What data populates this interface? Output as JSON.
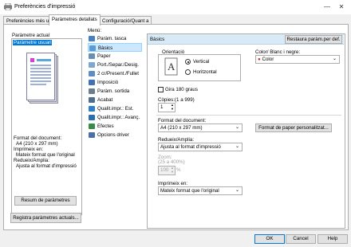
{
  "window": {
    "title": "Preferències d'impressió",
    "app_icon": "printer-icon"
  },
  "tabs": [
    {
      "label": "Preferències més usats",
      "active": false
    },
    {
      "label": "Paràmetres detallats",
      "active": true
    },
    {
      "label": "Configuració/Quant a",
      "active": false
    }
  ],
  "left": {
    "current_label": "Paràmetre actual",
    "current_value": "Paràmetre usuari",
    "summary": {
      "doc_format_label": "Format del document:",
      "doc_format_value": "A4 (210 x 297 mm)",
      "print_on_label": "Imprimeix en:",
      "print_on_value": "Mateix format que l'original",
      "reduce_label": "Redueix/Amplia:",
      "reduce_value": "Ajusta al format d'impressió"
    },
    "summary_button": "Resum de paràmetres",
    "register_button": "Registra paràmetres actuals..."
  },
  "menu": {
    "label": "Menú:",
    "items": [
      {
        "label": "Paràm. tasca",
        "icon": "job-settings-icon",
        "color": "#4a7fc1",
        "selected": false
      },
      {
        "label": "Bàsics",
        "icon": "basic-settings-icon",
        "color": "#5a9bd5",
        "selected": true
      },
      {
        "label": "Paper",
        "icon": "paper-icon",
        "color": "#6b8fb0",
        "selected": false
      },
      {
        "label": "Port./Separ./Desig.",
        "icon": "cover-icon",
        "color": "#7ea6cf",
        "selected": false
      },
      {
        "label": "2 cr/Present./Fullet",
        "icon": "duplex-icon",
        "color": "#5e8cc4",
        "selected": false
      },
      {
        "label": "Imposició",
        "icon": "imposition-icon",
        "color": "#3f72b5",
        "selected": false
      },
      {
        "label": "Paràm. sortida",
        "icon": "output-icon",
        "color": "#6c7d8e",
        "selected": false
      },
      {
        "label": "Acabat",
        "icon": "finishing-icon",
        "color": "#4d6e8f",
        "selected": false
      },
      {
        "label": "Qualit.impr.: Est.",
        "icon": "quality-standard-icon",
        "color": "#2f80c8",
        "selected": false
      },
      {
        "label": "Qualit.impr.: Avanç.",
        "icon": "quality-advanced-icon",
        "color": "#2a6fb1",
        "selected": false
      },
      {
        "label": "Efectes",
        "icon": "effects-icon",
        "color": "#3a8a4a",
        "selected": false
      },
      {
        "label": "Opcions driver",
        "icon": "driver-options-icon",
        "color": "#4a6fa8",
        "selected": false
      }
    ]
  },
  "basics": {
    "header": "Bàsics",
    "restore_button": "Restaura paràm.per def.",
    "orientation_label": "Orientació",
    "orientation_vertical": "Vertical",
    "orientation_horizontal": "Horitzontal",
    "orientation_selected": "Vertical",
    "color_label": "Color/ Blanc i negre:",
    "color_value": "Color",
    "rotate_label": "Gira 180 graus",
    "rotate_checked": false,
    "copies_label": "Còpies:(1 a 999)",
    "copies_value": "1",
    "doc_format_label": "Format del document:",
    "doc_format_value": "A4 (210 x 297 mm)",
    "custom_format_button": "Format de paper personalitzat...",
    "reduce_label": "Redueix/Amplia:",
    "reduce_value": "Ajusta al format d'impressió",
    "zoom_label": "Zoom:",
    "zoom_range": "(25 a 400%)",
    "zoom_value": "100",
    "zoom_unit": "%",
    "print_on_label": "Imprimeix en:",
    "print_on_value": "Mateix format que l'original"
  },
  "footer": {
    "ok": "OK",
    "cancel": "Cancel",
    "help": "Help"
  }
}
